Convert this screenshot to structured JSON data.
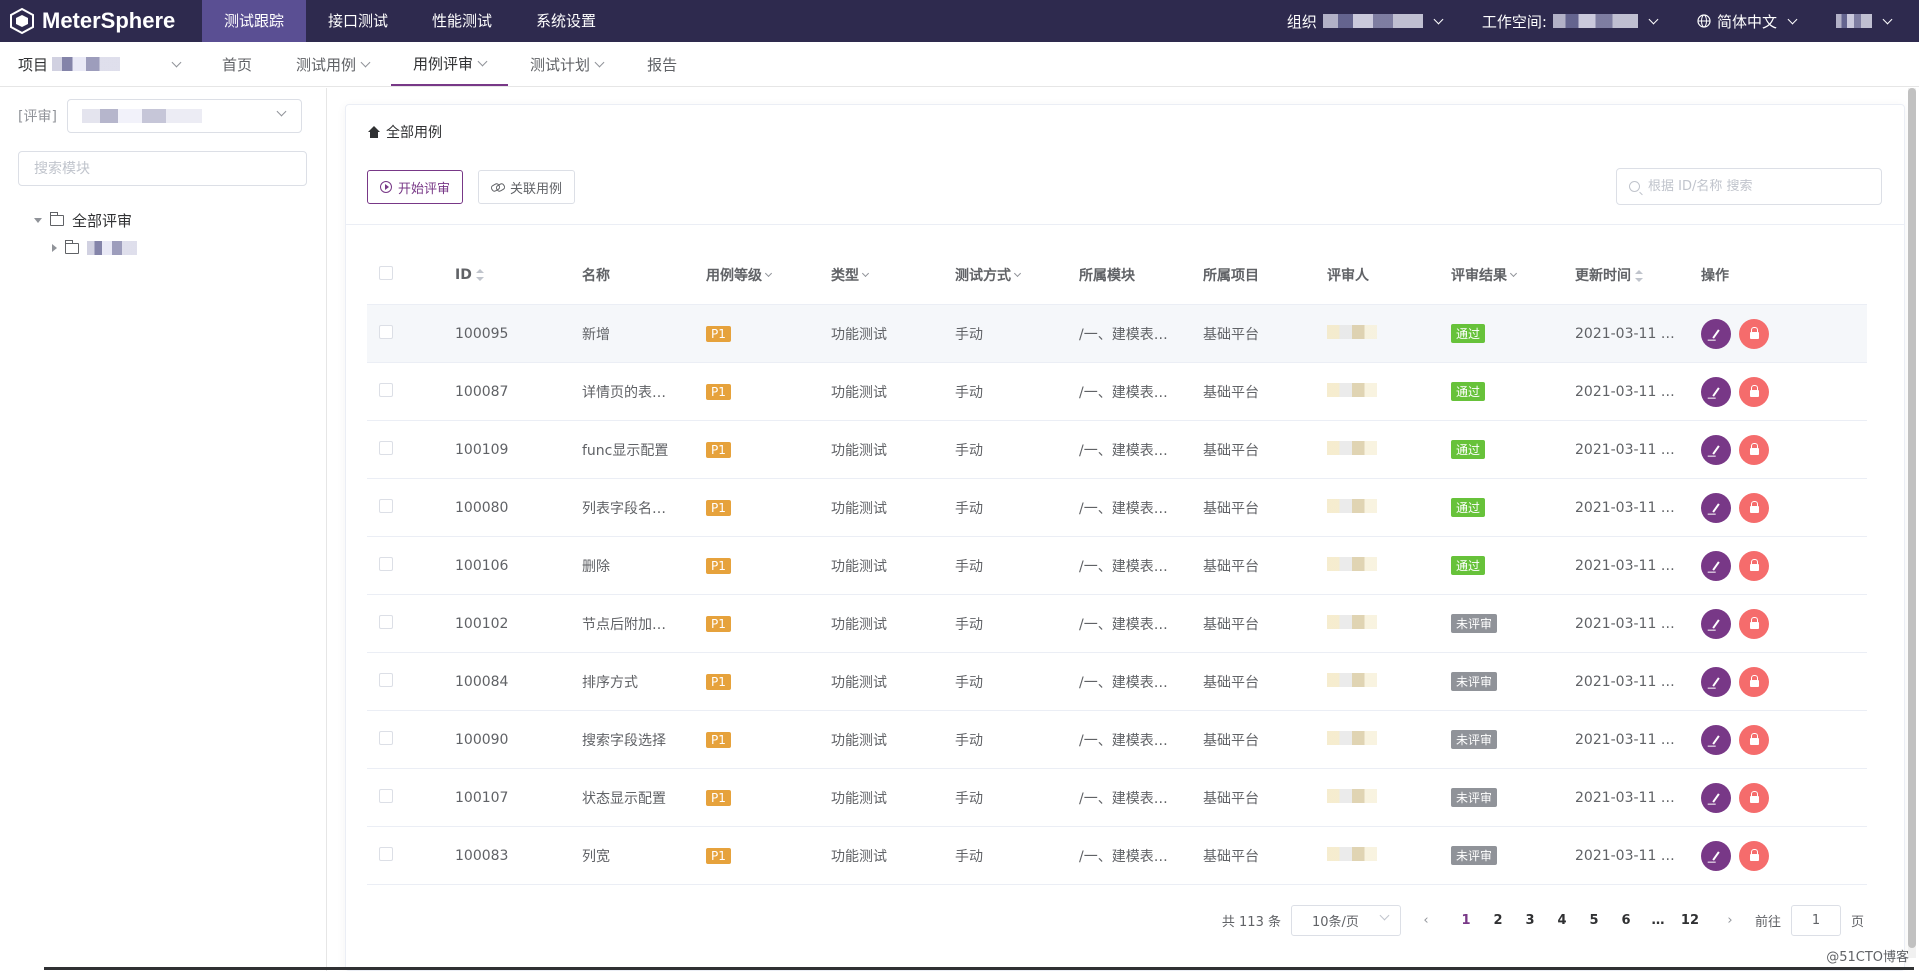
{
  "app": {
    "name": "MeterSphere"
  },
  "topnav": [
    {
      "label": "测试跟踪",
      "active": true
    },
    {
      "label": "接口测试",
      "active": false
    },
    {
      "label": "性能测试",
      "active": false
    },
    {
      "label": "系统设置",
      "active": false
    }
  ],
  "topright": {
    "org_label": "组织",
    "workspace_label": "工作空间:",
    "language": "简体中文"
  },
  "subnav": {
    "project_label": "项目",
    "items": [
      {
        "label": "首页",
        "dropdown": false,
        "active": false
      },
      {
        "label": "测试用例",
        "dropdown": true,
        "active": false
      },
      {
        "label": "用例评审",
        "dropdown": true,
        "active": true
      },
      {
        "label": "测试计划",
        "dropdown": true,
        "active": false
      },
      {
        "label": "报告",
        "dropdown": false,
        "active": false
      }
    ]
  },
  "left": {
    "review_label": "[评审]",
    "search_placeholder": "搜索模块",
    "tree_root": "全部评审"
  },
  "main": {
    "breadcrumb": "全部用例",
    "start_review": "开始评审",
    "link_cases": "关联用例",
    "search_placeholder": "根据 ID/名称 搜索"
  },
  "table": {
    "headers": [
      "ID",
      "名称",
      "用例等级",
      "类型",
      "测试方式",
      "所属模块",
      "所属项目",
      "评审人",
      "评审结果",
      "更新时间",
      "操作"
    ],
    "rows": [
      {
        "id": "100095",
        "name": "新增",
        "level": "P1",
        "type": "功能测试",
        "mode": "手动",
        "module": "/一、建模表…",
        "project": "基础平台",
        "result": "通过",
        "time": "2021-03-11 …"
      },
      {
        "id": "100087",
        "name": "详情页的表…",
        "level": "P1",
        "type": "功能测试",
        "mode": "手动",
        "module": "/一、建模表…",
        "project": "基础平台",
        "result": "通过",
        "time": "2021-03-11 …"
      },
      {
        "id": "100109",
        "name": "func显示配置",
        "level": "P1",
        "type": "功能测试",
        "mode": "手动",
        "module": "/一、建模表…",
        "project": "基础平台",
        "result": "通过",
        "time": "2021-03-11 …"
      },
      {
        "id": "100080",
        "name": "列表字段名…",
        "level": "P1",
        "type": "功能测试",
        "mode": "手动",
        "module": "/一、建模表…",
        "project": "基础平台",
        "result": "通过",
        "time": "2021-03-11 …"
      },
      {
        "id": "100106",
        "name": "删除",
        "level": "P1",
        "type": "功能测试",
        "mode": "手动",
        "module": "/一、建模表…",
        "project": "基础平台",
        "result": "通过",
        "time": "2021-03-11 …"
      },
      {
        "id": "100102",
        "name": "节点后附加…",
        "level": "P1",
        "type": "功能测试",
        "mode": "手动",
        "module": "/一、建模表…",
        "project": "基础平台",
        "result": "未评审",
        "time": "2021-03-11 …"
      },
      {
        "id": "100084",
        "name": "排序方式",
        "level": "P1",
        "type": "功能测试",
        "mode": "手动",
        "module": "/一、建模表…",
        "project": "基础平台",
        "result": "未评审",
        "time": "2021-03-11 …"
      },
      {
        "id": "100090",
        "name": "搜索字段选择",
        "level": "P1",
        "type": "功能测试",
        "mode": "手动",
        "module": "/一、建模表…",
        "project": "基础平台",
        "result": "未评审",
        "time": "2021-03-11 …"
      },
      {
        "id": "100107",
        "name": "状态显示配置",
        "level": "P1",
        "type": "功能测试",
        "mode": "手动",
        "module": "/一、建模表…",
        "project": "基础平台",
        "result": "未评审",
        "time": "2021-03-11 …"
      },
      {
        "id": "100083",
        "name": "列宽",
        "level": "P1",
        "type": "功能测试",
        "mode": "手动",
        "module": "/一、建模表…",
        "project": "基础平台",
        "result": "未评审",
        "time": "2021-03-11 …"
      }
    ]
  },
  "colors": {
    "passed": "#67c23a",
    "pending": "#909399",
    "brand": "#783887",
    "topbar": "#2e2a4e"
  },
  "pager": {
    "total": "共 113 条",
    "page_size": "10条/页",
    "pages": [
      "1",
      "2",
      "3",
      "4",
      "5",
      "6",
      "…",
      "12"
    ],
    "current": "1",
    "goto_label": "前往",
    "goto_value": "1",
    "page_suffix": "页"
  },
  "watermark": "@51CTO博客"
}
